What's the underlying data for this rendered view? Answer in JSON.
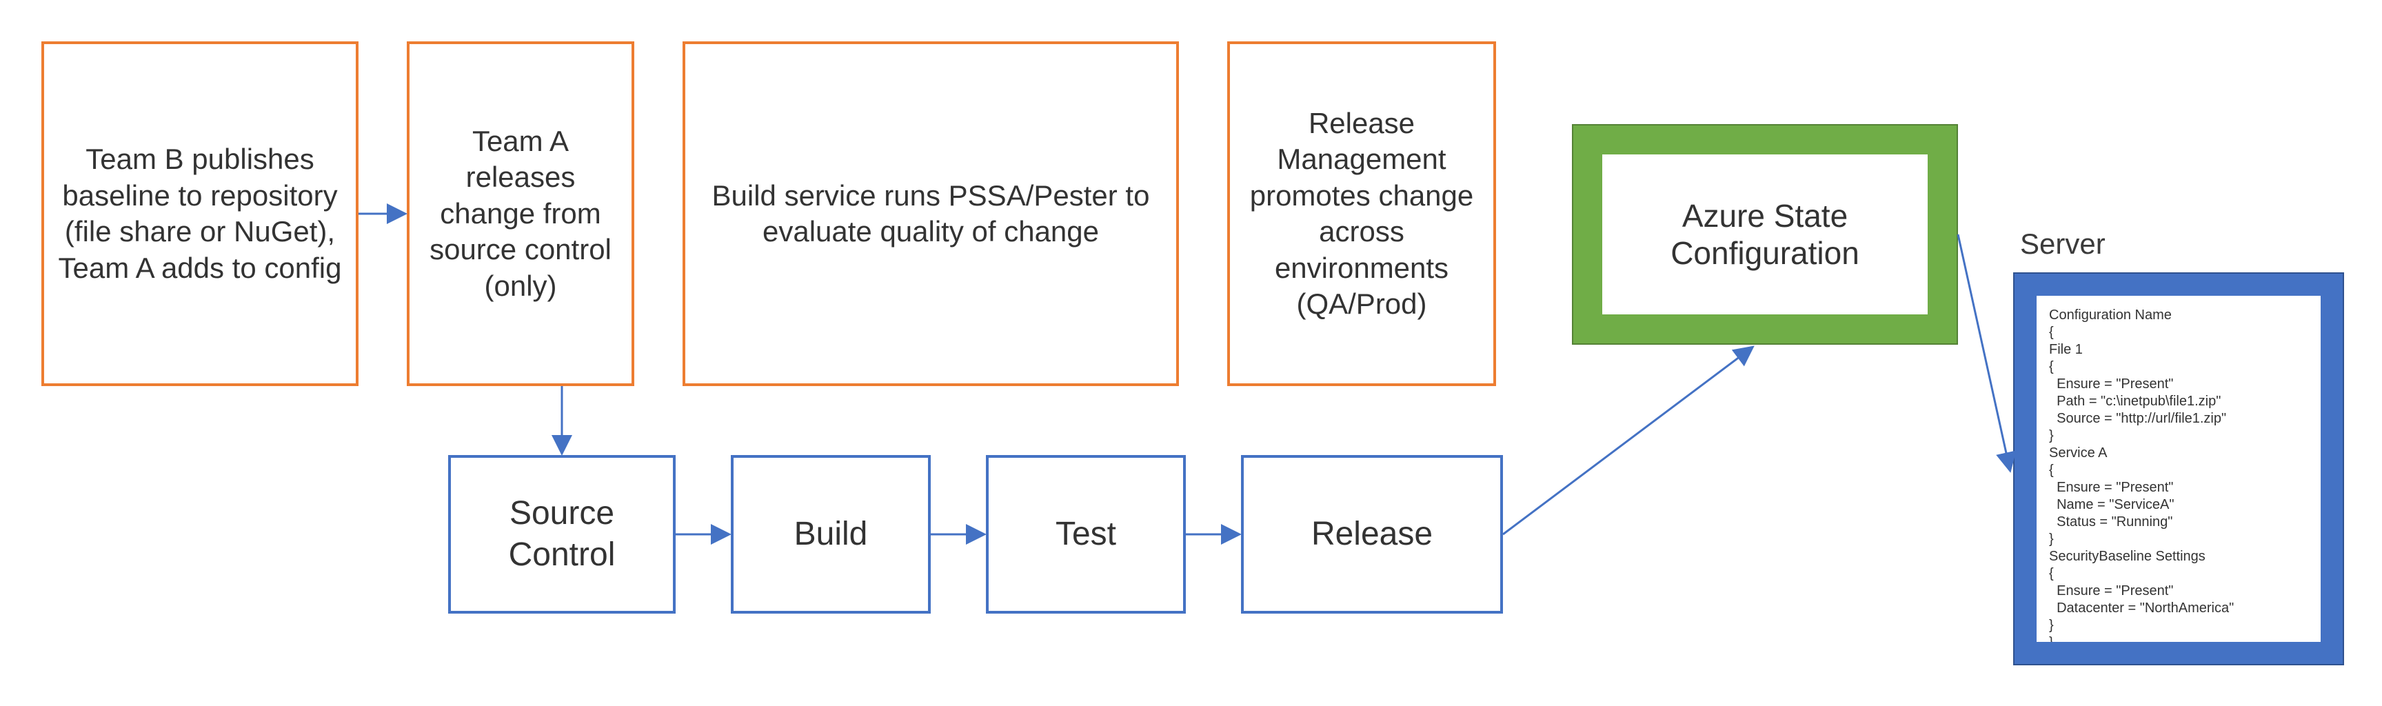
{
  "boxes": {
    "teamB": "Team B publishes baseline to repository (file share or NuGet), Team A adds to config",
    "teamA": "Team A releases change from source control (only)",
    "buildService": "Build service runs PSSA/Pester to evaluate quality of change",
    "releaseMgmt": "Release Management promotes change across environments (QA/Prod)",
    "sourceControl": "Source Control",
    "build": "Build",
    "test": "Test",
    "release": "Release",
    "azureState": "Azure State Configuration",
    "serverLabel": "Server"
  },
  "serverConfig": "Configuration Name\n{\nFile 1\n{\n  Ensure = \"Present\"\n  Path = \"c:\\inetpub\\file1.zip\"\n  Source = \"http://url/file1.zip\"\n}\nService A\n{\n  Ensure = \"Present\"\n  Name = \"ServiceA\"\n  Status = \"Running\"\n}\nSecurityBaseline Settings\n{\n  Ensure = \"Present\"\n  Datacenter = \"NorthAmerica\"\n}\n}"
}
